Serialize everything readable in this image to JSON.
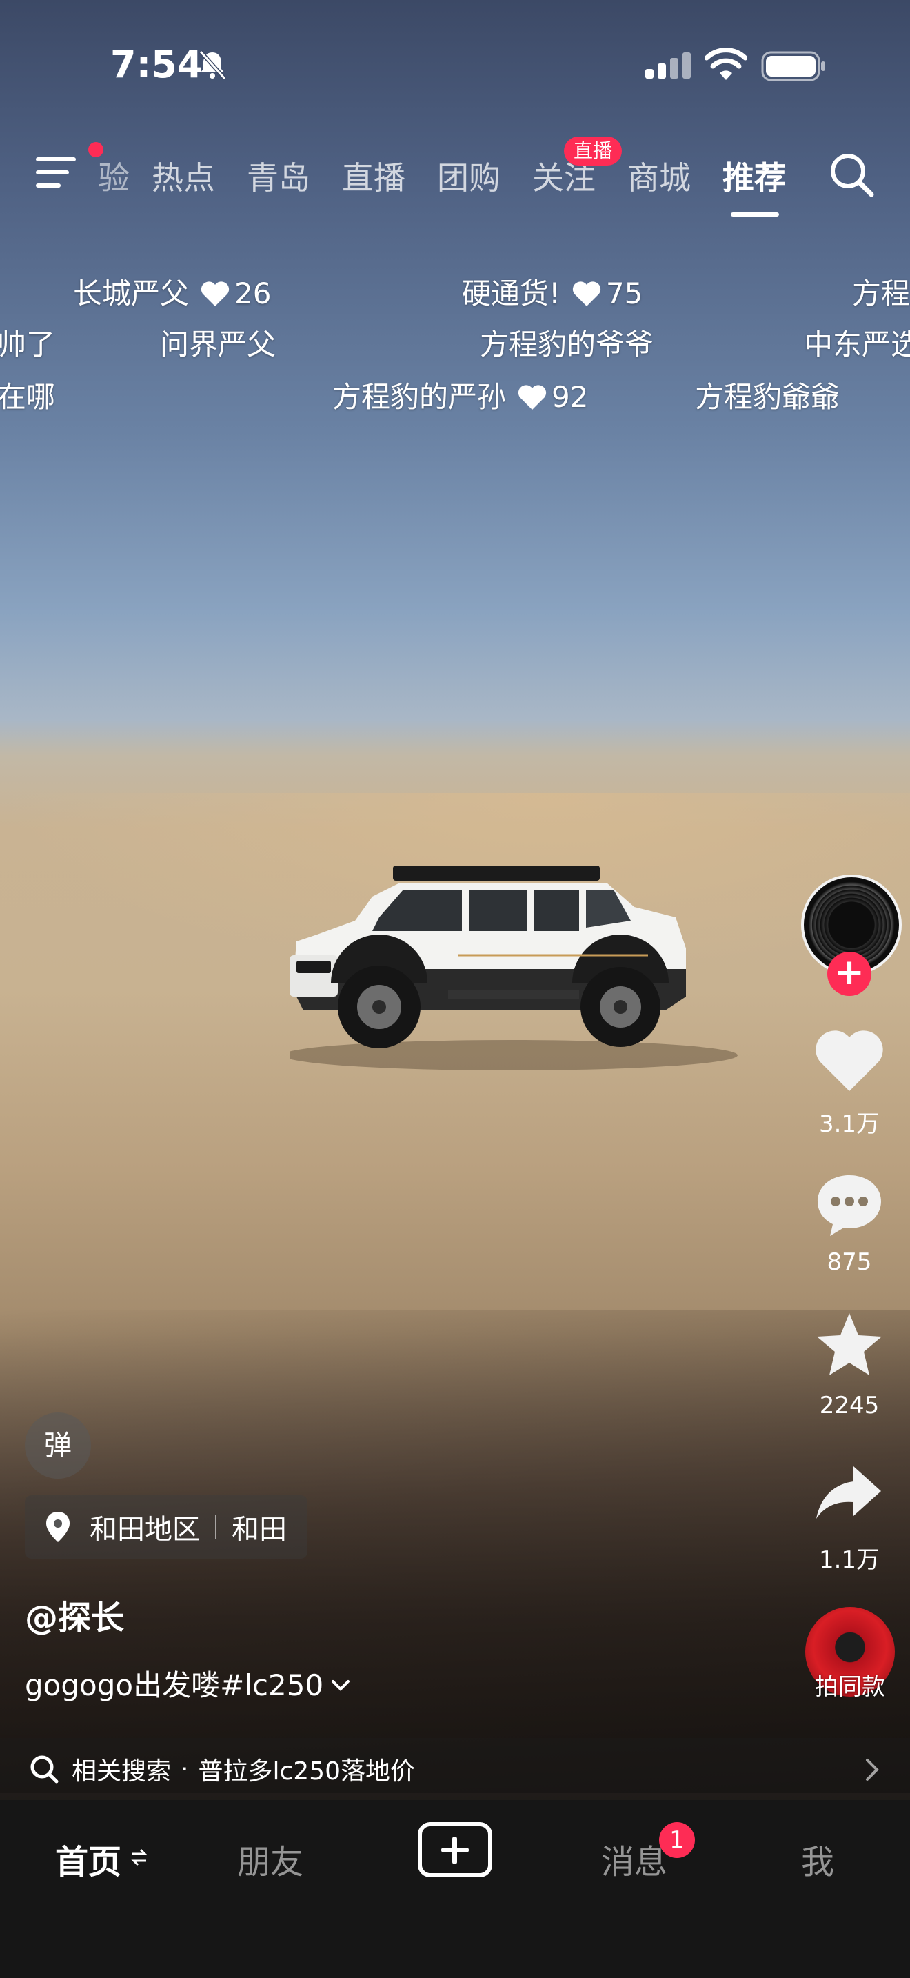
{
  "status_bar": {
    "time": "7:54",
    "icons": [
      "bell-muted-icon",
      "signal-icon",
      "wifi-icon",
      "battery-icon"
    ]
  },
  "top_tabs": {
    "partial": "验",
    "items": [
      "热点",
      "青岛",
      "直播",
      "团购",
      "关注",
      "商城",
      "推荐"
    ],
    "active": "推荐",
    "live_badge": "直播"
  },
  "danmaku": [
    {
      "text": "长城严父",
      "likes": "26"
    },
    {
      "text": "硬通货!",
      "likes": "75"
    },
    {
      "text": "方程"
    },
    {
      "text": "帅了"
    },
    {
      "text": "问界严父"
    },
    {
      "text": "方程豹的爷爷"
    },
    {
      "text": "中东严选"
    },
    {
      "text": "在哪"
    },
    {
      "text": "方程豹的严孙",
      "likes": "92"
    },
    {
      "text": "方程豹爺爺"
    }
  ],
  "right_rail": {
    "likes": "3.1万",
    "comments": "875",
    "favorites": "2245",
    "shares": "1.1万",
    "music_label": "拍同款"
  },
  "video_info": {
    "danmaku_toggle": "弹",
    "location_region": "和田地区",
    "location_city": "和田",
    "author": "@探长",
    "caption": "gogogo出发喽#lc250"
  },
  "related_search": {
    "prefix": "相关搜索",
    "dot": "·",
    "query": "普拉多lc250落地价"
  },
  "bottom_nav": {
    "home": "首页",
    "friends": "朋友",
    "messages": "消息",
    "messages_badge": "1",
    "me": "我"
  },
  "colors": {
    "accent": "#fe2c55",
    "nav_background": "#161616"
  }
}
